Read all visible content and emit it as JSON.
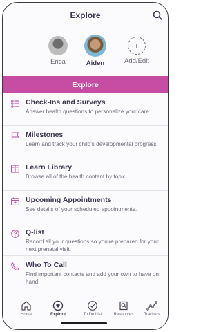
{
  "header": {
    "title": "Explore",
    "search_icon": "search-icon"
  },
  "profiles": [
    {
      "name": "Erica",
      "active": false
    },
    {
      "name": "Aiden",
      "active": true
    },
    {
      "name": "Add/Edit",
      "icon": "plus-icon"
    }
  ],
  "banner": {
    "label": "Explore",
    "color": "#c64da3"
  },
  "items": [
    {
      "title": "Check-Ins and Surveys",
      "desc": "Answer health questions to personalize your care.",
      "icon": "checklist-icon"
    },
    {
      "title": "Milestones",
      "desc": "Learn and track your child's developmental progress.",
      "icon": "flag-icon"
    },
    {
      "title": "Learn Library",
      "desc": "Browse all of the health content by topic.",
      "icon": "book-icon"
    },
    {
      "title": "Upcoming Appointments",
      "desc": "See details of your scheduled appointments.",
      "icon": "calendar-icon"
    },
    {
      "title": "Q-list",
      "desc": "Record all your questions so you're prepared for your next prenatal visit.",
      "icon": "question-icon"
    },
    {
      "title": "Who To Call",
      "desc": "Find important contacts and add your own to have on hand.",
      "icon": "phone-icon"
    }
  ],
  "tabs": [
    {
      "label": "Home",
      "icon": "home-icon",
      "active": false
    },
    {
      "label": "Explore",
      "icon": "compass-icon",
      "active": true
    },
    {
      "label": "To Do List",
      "icon": "check-circle-icon",
      "active": false
    },
    {
      "label": "Resources",
      "icon": "resources-icon",
      "active": false
    },
    {
      "label": "Trackers",
      "icon": "trend-icon",
      "active": false
    }
  ],
  "accent_color": "#c64da3"
}
